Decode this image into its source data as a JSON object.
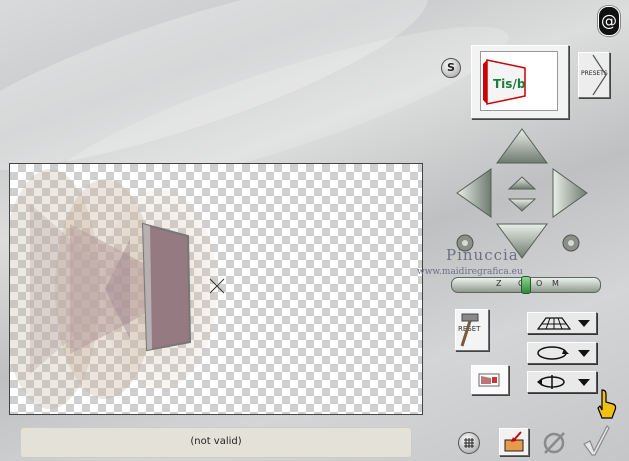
{
  "status": {
    "text": "(not valid)"
  },
  "zoom": {
    "letters": [
      "Z",
      "O",
      "O",
      "M"
    ],
    "level": 0.5
  },
  "buttons": {
    "presets_label": "PRESETS",
    "reset_label": "RESET",
    "s_label": "S",
    "info_label": "@"
  },
  "watermark": {
    "name": "Pinuccia",
    "site": "www.maidiregrafica.eu"
  },
  "preview": {
    "thumb_text": "Tis/b"
  },
  "icons": [
    "info-icon",
    "s-icon",
    "preview-thumbnail",
    "presets-arrow-icon",
    "arrow-up-icon",
    "arrow-down-icon",
    "arrow-left-icon",
    "arrow-right-icon",
    "arrow-up-small-icon",
    "arrow-down-small-icon",
    "rotate-left-icon",
    "rotate-right-icon",
    "grid-perspective-icon",
    "loop-icon",
    "flip-icon",
    "reset-hammer-icon",
    "thumbnail-icon",
    "grid-icon",
    "import-icon",
    "cancel-icon",
    "ok-check-icon",
    "pointing-hand-icon",
    "crosshair-icon"
  ]
}
